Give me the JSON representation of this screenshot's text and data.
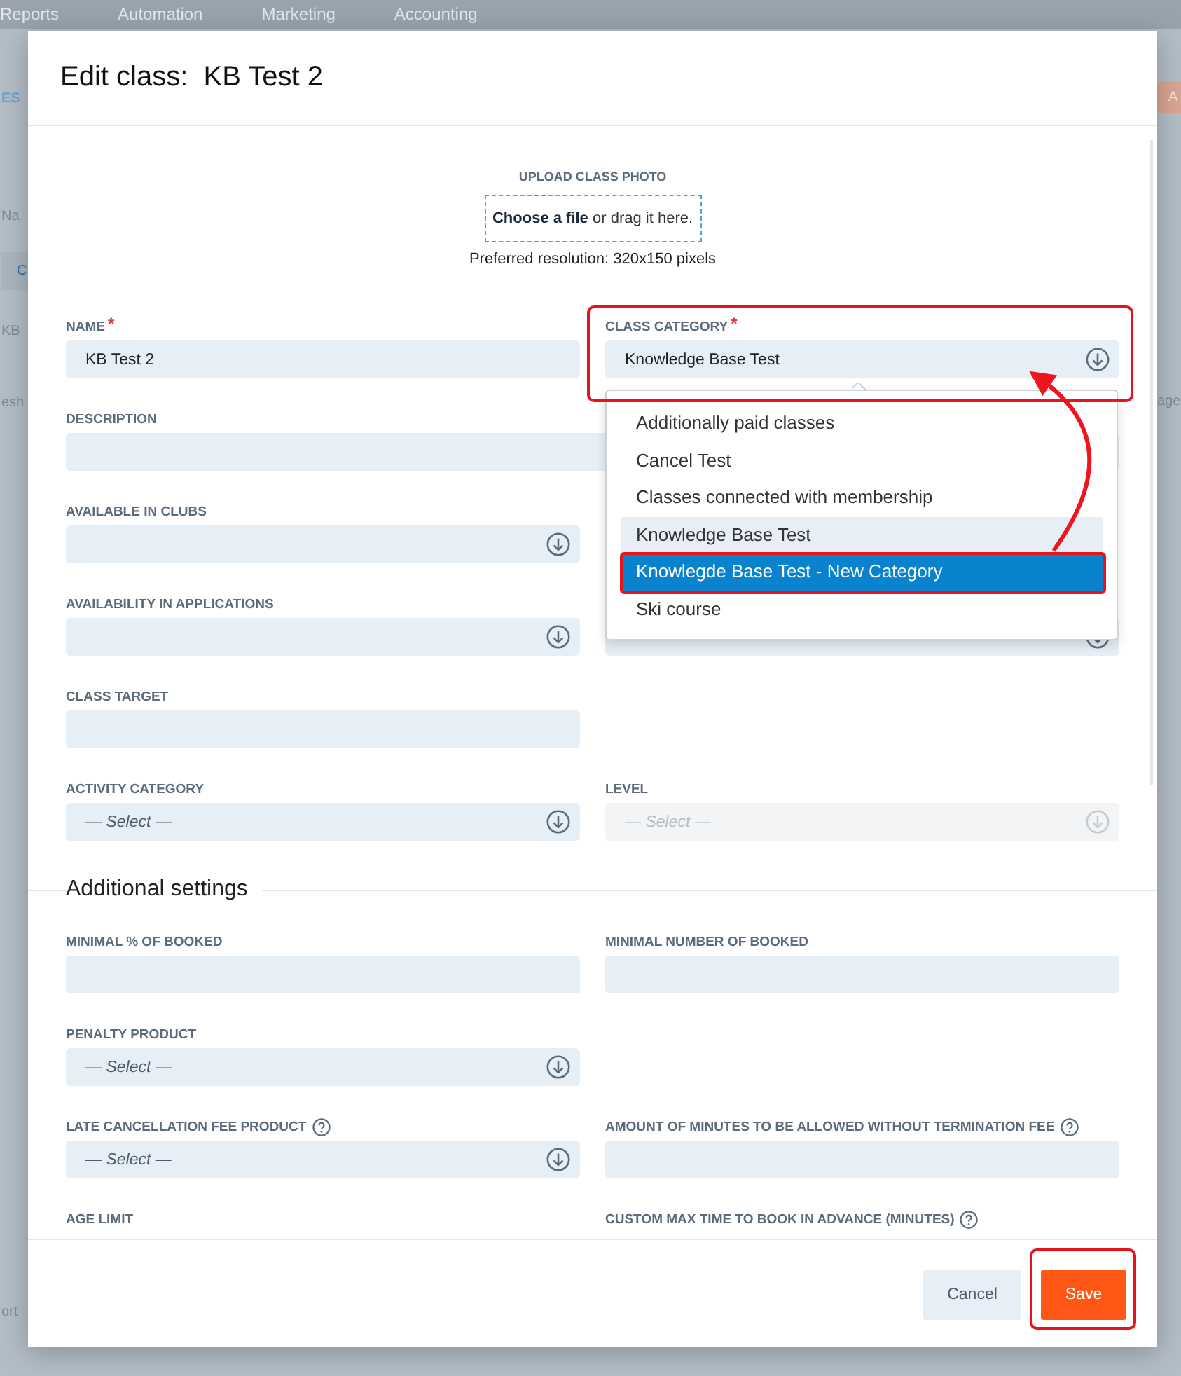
{
  "background": {
    "nav": [
      "Reports",
      "Automation",
      "Marketing",
      "Accounting"
    ],
    "left_fragments": [
      "ES",
      "Na",
      "C",
      "KB",
      "esh",
      "ort"
    ],
    "right_fragments": [
      "A",
      "age"
    ]
  },
  "modal": {
    "title": "Edit class:  KB Test 2",
    "upload": {
      "label": "UPLOAD CLASS PHOTO",
      "dropzone": "**Choose a file** or drag it here.",
      "hint": "Preferred resolution: 320x150 pixels"
    },
    "rows": [
      [
        {
          "label": "NAME",
          "required_mark": "*",
          "kind": "text",
          "value": "KB Test 2"
        },
        {
          "label": "CLASS CATEGORY",
          "required_mark": "*",
          "kind": "select",
          "value": "Knowledge Base Test"
        }
      ],
      [
        {
          "label": "DESCRIPTION",
          "kind": "text",
          "wide": true
        }
      ],
      [
        {
          "label": "AVAILABLE IN CLUBS",
          "kind": "select"
        }
      ],
      [
        {
          "label": "AVAILABILITY IN APPLICATIONS",
          "kind": "select"
        },
        {
          "kind": "select"
        }
      ],
      [
        {
          "label": "CLASS TARGET",
          "kind": "text"
        }
      ],
      [
        {
          "label": "ACTIVITY CATEGORY",
          "kind": "select",
          "placeholder": "— Select —"
        },
        {
          "label": "LEVEL",
          "kind": "select",
          "placeholder": "— Select —",
          "disabled": true
        }
      ]
    ],
    "section_title": "Additional settings",
    "additional_rows": [
      [
        {
          "label": "MINIMAL % OF BOOKED",
          "kind": "text"
        },
        {
          "label": "MINIMAL NUMBER OF BOOKED",
          "kind": "text"
        }
      ],
      [
        {
          "label": "PENALTY PRODUCT",
          "kind": "select",
          "placeholder": "— Select —"
        }
      ],
      [
        {
          "label": "LATE CANCELLATION FEE PRODUCT",
          "help": true,
          "kind": "select",
          "placeholder": "— Select —"
        },
        {
          "label": "AMOUNT OF MINUTES TO BE ALLOWED WITHOUT TERMINATION FEE",
          "help": true,
          "kind": "text"
        }
      ],
      [
        {
          "label": "AGE LIMIT"
        },
        {
          "label": "CUSTOM MAX TIME TO BOOK IN ADVANCE (MINUTES)",
          "help": true
        }
      ]
    ],
    "category_dropdown": {
      "options": [
        {
          "label": "Additionally paid classes",
          "selected": false,
          "highlighted": false
        },
        {
          "label": "Cancel Test",
          "selected": false,
          "highlighted": false
        },
        {
          "label": "Classes connected with membership",
          "selected": false,
          "highlighted": false
        },
        {
          "label": "Knowledge Base Test",
          "selected": true,
          "highlighted": false
        },
        {
          "label": "Knowlegde Base Test - New Category",
          "selected": false,
          "highlighted": true
        },
        {
          "label": "Ski course",
          "selected": false,
          "highlighted": false
        }
      ]
    },
    "buttons": [
      {
        "label": "Cancel",
        "kind": "secondary"
      },
      {
        "label": "Save",
        "kind": "primary"
      }
    ]
  }
}
